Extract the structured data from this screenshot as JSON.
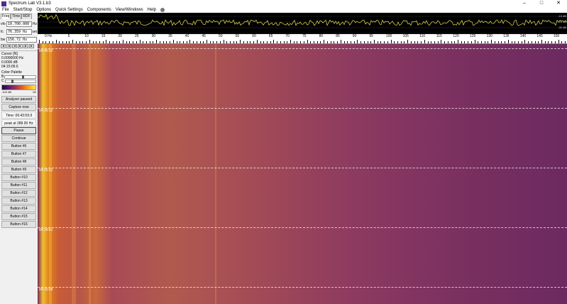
{
  "window": {
    "title": "Spectrum Lab V3.1.b3",
    "min": "–",
    "max": "□",
    "close": "✕"
  },
  "menu": [
    "File",
    "Start/Stop",
    "Options",
    "Quick Settings",
    "Components",
    "View/Windows",
    "Help"
  ],
  "sidebar": {
    "tabs": [
      "Freq",
      "Time",
      "RDF"
    ],
    "vfo": {
      "label": "vfo",
      "value": "10.700.000",
      "unit": "Hz"
    },
    "fc": {
      "label": "fc",
      "value": "76.359 Hz",
      "unit": "set"
    },
    "bw": {
      "label": "bw",
      "value": "156.72 Hz"
    },
    "arrows": [
      "◄",
      "◄",
      "◄",
      "►",
      "►",
      "►"
    ],
    "cursor": {
      "title": "Cursor [N]",
      "freq": "0.0000000 Hz",
      "level": "0.0000 dB",
      "time": "04:15:09.6"
    },
    "palette": {
      "title": "Color Palette",
      "b_label": "B",
      "c_label": "C",
      "min_label": "-100 dB",
      "max_label": "-50"
    },
    "analyzer_status": "Analyzer paused",
    "capture": "Capture now",
    "time": "Time:  06:43:59.9",
    "peak": "peak at 288.90 Hz",
    "pause": "Pause",
    "continue": "Continue",
    "buttons": [
      "Button #6",
      "Button #7",
      "Button #8",
      "Button #9",
      "Button #10",
      "Button #11",
      "Button #12",
      "Button #13",
      "Button #14",
      "Button #15",
      "Button #16"
    ]
  },
  "spectrum": {
    "db_labels": [
      "-10 dB",
      "-20 dB",
      "-30 dB"
    ]
  },
  "scale": {
    "unit_label": "0 Hz",
    "labels": [
      "5",
      "10",
      "15",
      "20",
      "25",
      "30",
      "35",
      "40",
      "45",
      "50",
      "55",
      "60",
      "65",
      "70",
      "75",
      "80",
      "85",
      "90",
      "95",
      "100",
      "105",
      "110",
      "115",
      "120",
      "125",
      "130",
      "135",
      "140",
      "145",
      "150"
    ]
  },
  "waterfall": {
    "timestamps": [
      "04:40:22",
      "04:33:12",
      "04:25:31",
      "04:18:51",
      "04:10:09"
    ]
  },
  "colors": {
    "accent": "#f8a91e",
    "background": "#f0f0f0"
  }
}
